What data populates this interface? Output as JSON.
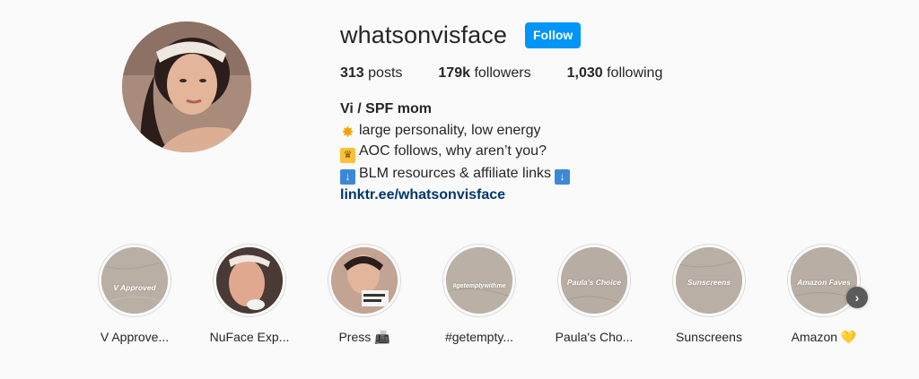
{
  "profile": {
    "username": "whatsonvisface",
    "follow_label": "Follow",
    "stats": {
      "posts_count": "313",
      "posts_label": "posts",
      "followers_count": "179k",
      "followers_label": "followers",
      "following_count": "1,030",
      "following_label": "following"
    },
    "bio": {
      "full_name": "Vi / SPF mom",
      "line1": "large personality, low energy",
      "line2": "AOC follows, why aren’t you?",
      "line3": "BLM resources & affiliate links",
      "link": "linktr.ee/whatsonvisface"
    }
  },
  "highlights": [
    {
      "label": "V Approve...",
      "cover_text": "V Approved",
      "type": "texture"
    },
    {
      "label": "NuFace Exp...",
      "cover_text": "",
      "type": "photo"
    },
    {
      "label": "Press 📠",
      "cover_text": "",
      "type": "photo"
    },
    {
      "label": "#getempty...",
      "cover_text": "#getemptywithme",
      "type": "texture"
    },
    {
      "label": "Paula's Cho...",
      "cover_text": "Paula's Choice",
      "type": "texture"
    },
    {
      "label": "Sunscreens",
      "cover_text": "Sunscreens",
      "type": "texture"
    },
    {
      "label": "Amazon 💛",
      "cover_text": "Amazon Faves",
      "type": "texture"
    }
  ],
  "icons": {
    "bio_line1": "collision-spark-icon",
    "bio_line2": "crown-icon",
    "bio_line3": "down-arrow-icon",
    "next": "chevron-right-icon"
  },
  "colors": {
    "follow_button": "#0095f6",
    "link": "#00376b",
    "background": "#fafafa"
  }
}
